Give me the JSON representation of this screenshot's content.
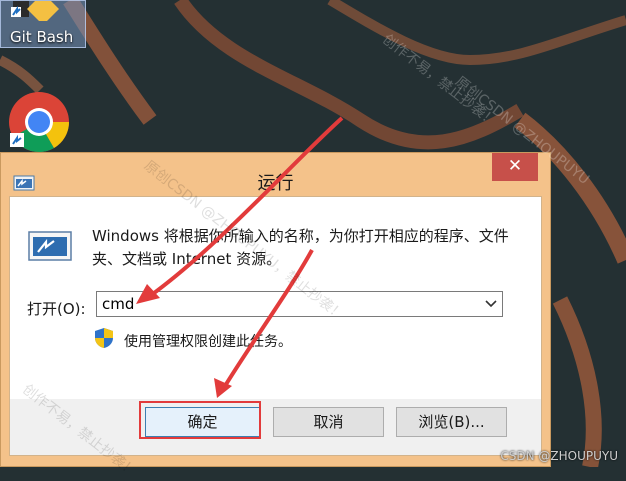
{
  "desktop": {
    "icons": [
      {
        "label": "Git Bash",
        "icon": "git-bash-icon"
      },
      {
        "label": "",
        "icon": "chrome-icon"
      }
    ]
  },
  "dialog": {
    "title": "运行",
    "close_glyph": "✕",
    "description": "Windows 将根据你所输入的名称，为你打开相应的程序、文件夹、文档或 Internet 资源。",
    "open_label": "打开(O):",
    "open_value": "cmd",
    "admin_note": "使用管理权限创建此任务。",
    "buttons": {
      "ok": "确定",
      "cancel": "取消",
      "browse": "浏览(B)..."
    }
  },
  "watermark": {
    "texts": [
      "创作不易，禁止抄袭！",
      "原创CSDN @ZHOUPUYU",
      "原创CSDN @ZHOUPUYU，禁止抄袭！"
    ],
    "credit": "CSDN @ZHOUPUYU"
  },
  "colors": {
    "dialog_frame": "#f4c28a",
    "close_button": "#c7504a",
    "annotation": "#e23b3b"
  }
}
